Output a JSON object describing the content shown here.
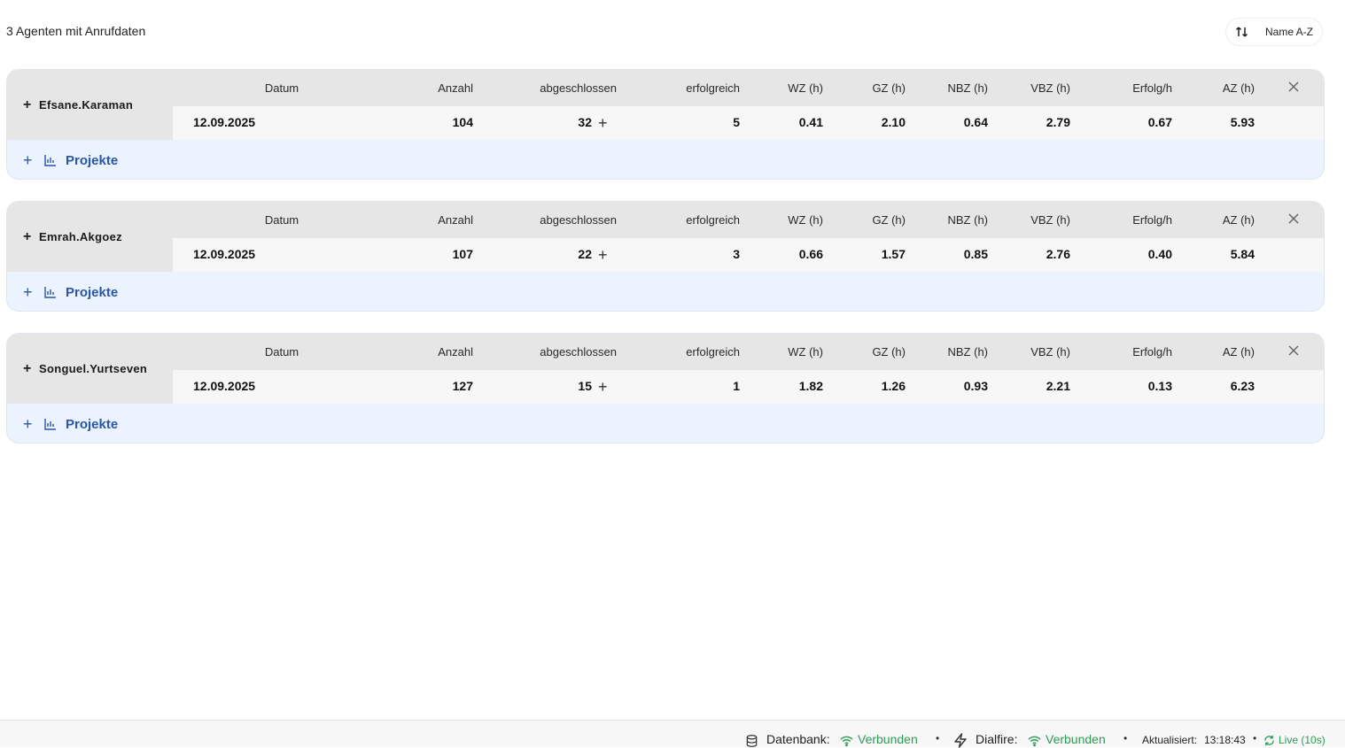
{
  "summary": "3 Agenten mit Anrufdaten",
  "sort": {
    "label": "Name A-Z"
  },
  "columns": [
    "Datum",
    "Anzahl",
    "abgeschlossen",
    "erfolgreich",
    "WZ (h)",
    "GZ (h)",
    "NBZ (h)",
    "VBZ (h)",
    "Erfolg/h",
    "AZ (h)"
  ],
  "agents": [
    {
      "name": "Efsane.Karaman",
      "row": [
        "12.09.2025",
        "104",
        "32",
        "5",
        "0.41",
        "2.10",
        "0.64",
        "2.79",
        "0.67",
        "5.93"
      ],
      "projects_label": "Projekte"
    },
    {
      "name": "Emrah.Akgoez",
      "row": [
        "12.09.2025",
        "107",
        "22",
        "3",
        "0.66",
        "1.57",
        "0.85",
        "2.76",
        "0.40",
        "5.84"
      ],
      "projects_label": "Projekte"
    },
    {
      "name": "Songuel.Yurtseven",
      "row": [
        "12.09.2025",
        "127",
        "15",
        "1",
        "1.82",
        "1.26",
        "0.93",
        "2.21",
        "0.13",
        "6.23"
      ],
      "projects_label": "Projekte"
    }
  ],
  "footer": {
    "db_label": "Datenbank:",
    "db_status": "Verbunden",
    "dialfire_label": "Dialfire:",
    "dialfire_status": "Verbunden",
    "updated_label": "Aktualisiert:",
    "updated_time": "13:18:43",
    "live": "Live (10s)"
  },
  "colors": {
    "accent": "#2a55a8",
    "status_ok": "#2e9a56",
    "header_bg": "#e6e6e6",
    "projects_bg": "#eaf3fe"
  }
}
